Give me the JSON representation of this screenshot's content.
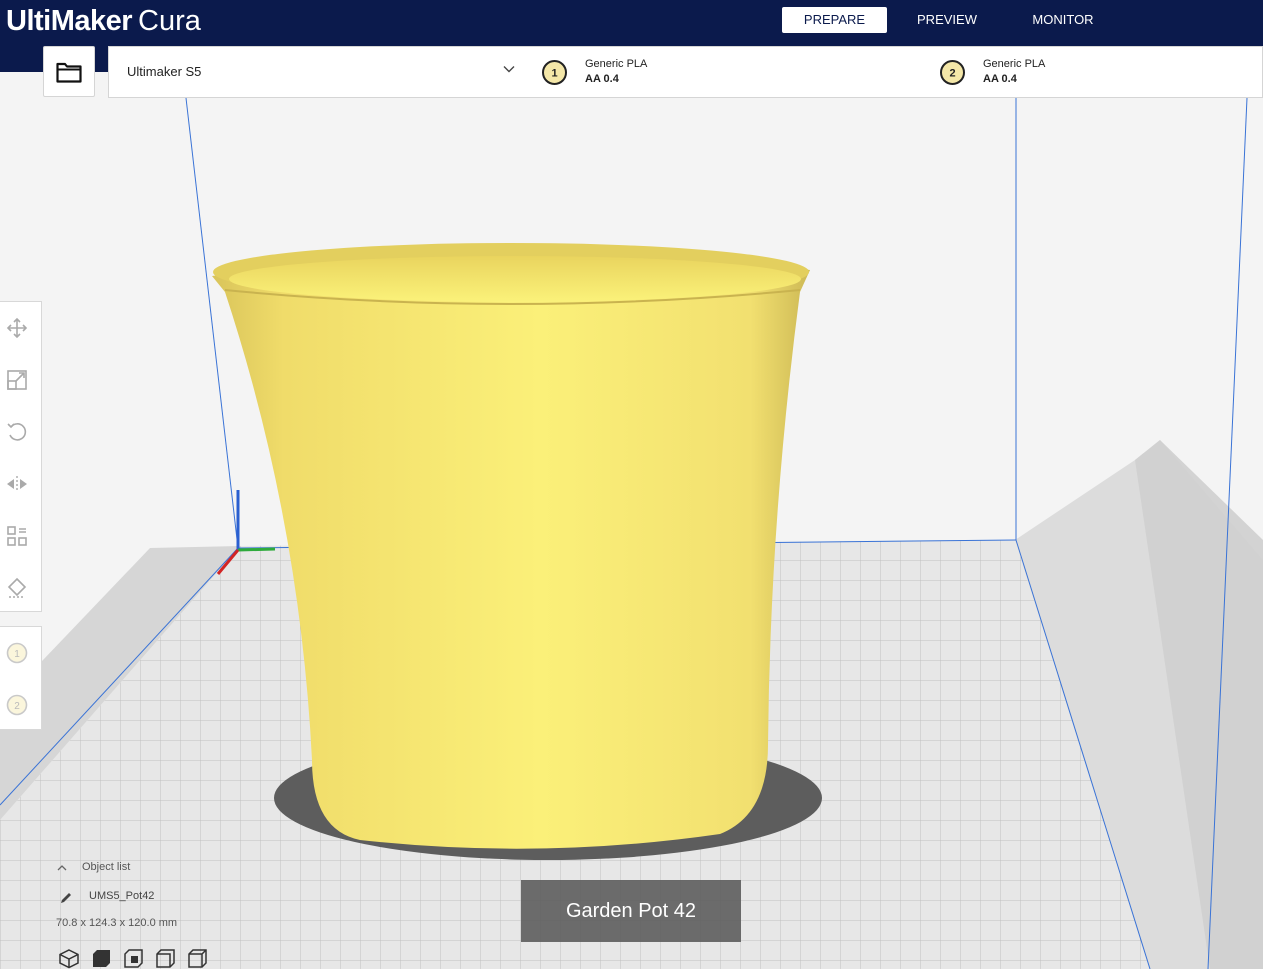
{
  "app": {
    "brand": "UltiMaker",
    "product": "Cura"
  },
  "nav_tabs": [
    {
      "label": "PREPARE",
      "active": true
    },
    {
      "label": "PREVIEW",
      "active": false
    },
    {
      "label": "MONITOR",
      "active": false
    }
  ],
  "machine": {
    "name": "Ultimaker S5"
  },
  "extruders": [
    {
      "index": "1",
      "material": "Generic PLA",
      "nozzle": "AA 0.4"
    },
    {
      "index": "2",
      "material": "Generic PLA",
      "nozzle": "AA 0.4"
    }
  ],
  "tools": [
    "move-icon",
    "scale-icon",
    "rotate-icon",
    "mirror-icon",
    "per-model-settings-icon",
    "support-blocker-icon"
  ],
  "extruder_tools": [
    "1",
    "2"
  ],
  "object_list": {
    "header": "Object list",
    "object_name": "UMS5_Pot42",
    "dimensions": "70.8 x 124.3 x 120.0 mm"
  },
  "caption": "Garden Pot 42",
  "colors": {
    "header": "#0b1a4c",
    "model": "#f7eb78",
    "build_plate": "#e6e6e6",
    "badge": "#f4e7a8"
  }
}
